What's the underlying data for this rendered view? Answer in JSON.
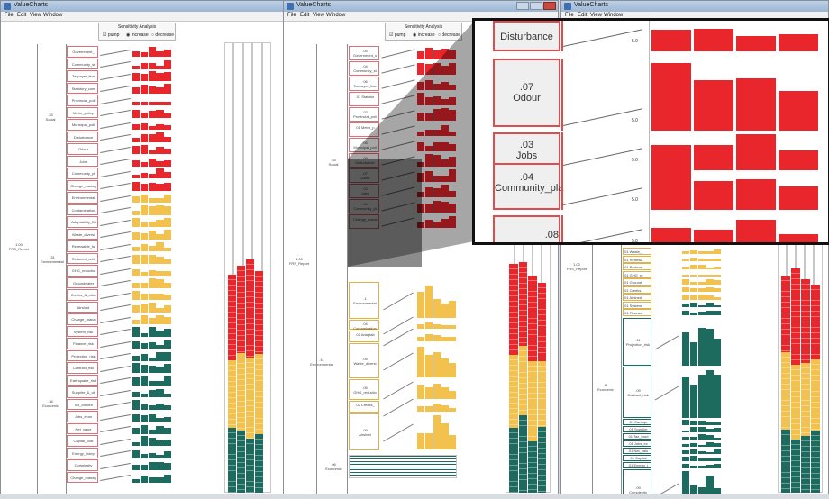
{
  "app_title": "ValueCharts",
  "menu": [
    "File",
    "Edit",
    "View",
    "Window"
  ],
  "sensitivity": {
    "title": "Sensitivity Analysis",
    "options": [
      "pump",
      "increase",
      "decrease"
    ]
  },
  "root": {
    "weight": "1.00",
    "name": "FRS_Report"
  },
  "groups": {
    "social": {
      "weight": ".33",
      "name": "Social"
    },
    "social_mid": {
      "weight": ".53",
      "name": "Social"
    },
    "environmental": {
      "weight": ".31",
      "name": "Environmental"
    },
    "environmental_mid": {
      "weight": ".41",
      "name": "Environmental"
    },
    "economic": {
      "weight": ".36",
      "name": "Economic"
    },
    "economic_mid": {
      "weight": ".06",
      "name": "Economic"
    },
    "economic_right": {
      "weight": ".41",
      "name": "Economic"
    }
  },
  "left_attributes": {
    "social": [
      "Government_",
      "Community_st",
      "Taxpayer_fina",
      "Statutory_com",
      "Provincial_poli",
      "Metro_policy",
      "Municipal_poli",
      "Disturbance",
      "Odour",
      "Jobs",
      "Community_pl",
      "Change_manag"
    ],
    "environmental": [
      "Environmental",
      "Contamination",
      "Adaptability_Bi",
      "Waste_diversi",
      "Renewable_fu",
      "Reduced_vehi",
      "GHG_reductio",
      "Groundwater",
      "Creeks_&_othe",
      "Airshed",
      "Change_mana"
    ],
    "economic": [
      "System_risk",
      "Finance_risk",
      "Projection_risk",
      "Contract_risk",
      "Earthquake_risk",
      "Supplier_&_cli",
      "Tax_burden",
      "Jobs_econ",
      "Net_value",
      "Capital_cost",
      "Energy_indep",
      "Complexity",
      "Change_manag"
    ]
  },
  "mid_attributes": {
    "social": [
      "Government_s",
      "Community_st",
      "Taxpayer_fina",
      ".01 Statutor",
      "Provincial_poli",
      ".01 Metro_p",
      "Municipal_poli",
      "Disturbance",
      "Odour",
      "Jobs",
      "Community_pl",
      "Change_mana"
    ],
    "environmental": [
      "Environmental",
      "Contamination",
      ".02 Adaptab",
      "Waste_diversi",
      "GHG_reductio",
      ".02 Creeks_",
      "Airshed"
    ]
  },
  "mid_weights": {
    "social": [
      ".04",
      ".04",
      ".06",
      "",
      ".03",
      "",
      ".05",
      ".09",
      ".07",
      ".03",
      ".04",
      ""
    ],
    "environmental": [
      ".1",
      ".04",
      "",
      ".05",
      ".05",
      "",
      ".09"
    ]
  },
  "right_attributes": {
    "environmental": [
      ".01 Waste_",
      ".01 Renewa",
      ".01 Reduce",
      ".01 GHG_re",
      ".01 Ground",
      ".01 Creeks",
      ".01 Airshed",
      ".01 System",
      ".01 Finance"
    ],
    "economic": [
      "Projection_risk",
      "Contract_risk",
      ".01 Earthqu",
      ".01 Supplier",
      ".01 Tax_burd",
      ".01 Jobs_ec",
      ".01 Net_valu",
      ".01 Capital",
      ".01 Energy_i",
      "Complexity"
    ],
    "economic_weights": [
      ".11",
      ".09",
      "",
      "",
      "",
      "",
      "",
      "",
      "",
      ".09"
    ]
  },
  "zoom": {
    "items": [
      {
        "weight": "",
        "name": "Disturbance"
      },
      {
        "weight": ".07",
        "name": "Odour"
      },
      {
        "weight": ".03",
        "name": "Jobs"
      },
      {
        "weight": ".04",
        "name": "Community_pla"
      },
      {
        "weight": ".08",
        "name": ""
      }
    ],
    "five": "5.0"
  },
  "colors": {
    "social": "#e8262b",
    "environmental": "#f2c14e",
    "economic": "#1c6b5e",
    "border": "#d9737a",
    "titlebar": "#a9c0dd"
  }
}
